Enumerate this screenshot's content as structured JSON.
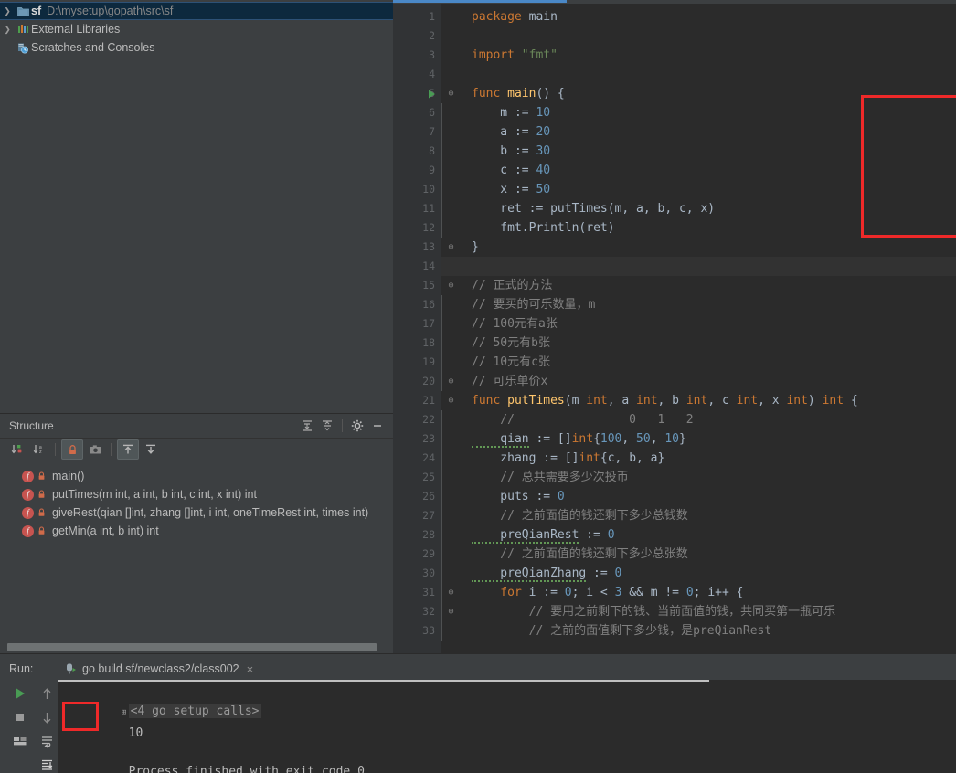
{
  "project_tree": {
    "items": [
      {
        "name": "sf",
        "path": "D:\\mysetup\\gopath\\src\\sf",
        "icon": "folder-module-icon",
        "arrow": "›",
        "selected": true,
        "indent": 0
      },
      {
        "name": "External Libraries",
        "path": "",
        "icon": "libraries-icon",
        "arrow": "›",
        "selected": false,
        "indent": 0
      },
      {
        "name": "Scratches and Consoles",
        "path": "",
        "icon": "scratches-icon",
        "arrow": "",
        "selected": false,
        "indent": 0
      }
    ]
  },
  "structure": {
    "title": "Structure",
    "header_icons": [
      {
        "name": "expand-all-icon"
      },
      {
        "name": "collapse-all-icon"
      },
      {
        "name": "gear-icon"
      },
      {
        "name": "hide-icon"
      }
    ],
    "toolbar_buttons": [
      {
        "name": "sort-by-visibility-icon",
        "active": false
      },
      {
        "name": "sort-alphabetically-icon",
        "active": false
      },
      {
        "name": "show-non-public-icon",
        "active": true
      },
      {
        "name": "show-fields-icon",
        "active": false
      },
      {
        "name": "show-inherited-icon",
        "active": true
      },
      {
        "name": "show-anonymous-icon",
        "active": false
      }
    ],
    "items": [
      {
        "label": "main()"
      },
      {
        "label": "putTimes(m int, a int, b int, c int, x int) int"
      },
      {
        "label": "giveRest(qian []int, zhang []int, i int, oneTimeRest int, times int)"
      },
      {
        "label": "getMin(a int, b int) int"
      }
    ]
  },
  "editor": {
    "lines": [
      {
        "n": 1,
        "fold": "",
        "indent": false,
        "caret": false,
        "tokens": [
          {
            "t": "package ",
            "c": "kw"
          },
          {
            "t": "main",
            "c": "id"
          }
        ]
      },
      {
        "n": 2,
        "fold": "",
        "indent": false,
        "caret": false,
        "tokens": []
      },
      {
        "n": 3,
        "fold": "",
        "indent": false,
        "caret": false,
        "tokens": [
          {
            "t": "import ",
            "c": "kw"
          },
          {
            "t": "\"fmt\"",
            "c": "str"
          }
        ]
      },
      {
        "n": 4,
        "fold": "",
        "indent": false,
        "caret": false,
        "tokens": []
      },
      {
        "n": 5,
        "fold": "⊖",
        "indent": false,
        "caret": false,
        "runmark": true,
        "tokens": [
          {
            "t": "func ",
            "c": "kw"
          },
          {
            "t": "main",
            "c": "fn"
          },
          {
            "t": "() {",
            "c": "id"
          }
        ]
      },
      {
        "n": 6,
        "fold": "",
        "indent": true,
        "caret": false,
        "tokens": [
          {
            "t": "    m := ",
            "c": "id"
          },
          {
            "t": "10",
            "c": "num"
          }
        ]
      },
      {
        "n": 7,
        "fold": "",
        "indent": true,
        "caret": false,
        "tokens": [
          {
            "t": "    a := ",
            "c": "id"
          },
          {
            "t": "20",
            "c": "num"
          }
        ]
      },
      {
        "n": 8,
        "fold": "",
        "indent": true,
        "caret": false,
        "tokens": [
          {
            "t": "    b := ",
            "c": "id"
          },
          {
            "t": "30",
            "c": "num"
          }
        ]
      },
      {
        "n": 9,
        "fold": "",
        "indent": true,
        "caret": false,
        "tokens": [
          {
            "t": "    c := ",
            "c": "id"
          },
          {
            "t": "40",
            "c": "num"
          }
        ]
      },
      {
        "n": 10,
        "fold": "",
        "indent": true,
        "caret": false,
        "tokens": [
          {
            "t": "    x := ",
            "c": "id"
          },
          {
            "t": "50",
            "c": "num"
          }
        ]
      },
      {
        "n": 11,
        "fold": "",
        "indent": true,
        "caret": false,
        "tokens": [
          {
            "t": "    ret := ",
            "c": "id"
          },
          {
            "t": "putTimes",
            "c": "id"
          },
          {
            "t": "(m, a, b, c, x)",
            "c": "id"
          }
        ]
      },
      {
        "n": 12,
        "fold": "",
        "indent": true,
        "caret": false,
        "tokens": [
          {
            "t": "    fmt.",
            "c": "id"
          },
          {
            "t": "Println",
            "c": "id"
          },
          {
            "t": "(ret)",
            "c": "id"
          }
        ]
      },
      {
        "n": 13,
        "fold": "⊖",
        "indent": false,
        "caret": false,
        "tokens": [
          {
            "t": "}",
            "c": "id"
          }
        ]
      },
      {
        "n": 14,
        "fold": "",
        "indent": false,
        "caret": true,
        "tokens": []
      },
      {
        "n": 15,
        "fold": "⊖",
        "indent": false,
        "caret": false,
        "tokens": [
          {
            "t": "// 正式的方法",
            "c": "cmt"
          }
        ]
      },
      {
        "n": 16,
        "fold": "",
        "indent": true,
        "caret": false,
        "tokens": [
          {
            "t": "// 要买的可乐数量，m",
            "c": "cmt"
          }
        ]
      },
      {
        "n": 17,
        "fold": "",
        "indent": true,
        "caret": false,
        "tokens": [
          {
            "t": "// 100元有a张",
            "c": "cmt"
          }
        ]
      },
      {
        "n": 18,
        "fold": "",
        "indent": true,
        "caret": false,
        "tokens": [
          {
            "t": "// 50元有b张",
            "c": "cmt"
          }
        ]
      },
      {
        "n": 19,
        "fold": "",
        "indent": true,
        "caret": false,
        "tokens": [
          {
            "t": "// 10元有c张",
            "c": "cmt"
          }
        ]
      },
      {
        "n": 20,
        "fold": "⊖",
        "indent": true,
        "caret": false,
        "tokens": [
          {
            "t": "// 可乐单价x",
            "c": "cmt"
          }
        ]
      },
      {
        "n": 21,
        "fold": "⊖",
        "indent": false,
        "caret": false,
        "tokens": [
          {
            "t": "func ",
            "c": "kw"
          },
          {
            "t": "putTimes",
            "c": "fn"
          },
          {
            "t": "(m ",
            "c": "id"
          },
          {
            "t": "int",
            "c": "typ"
          },
          {
            "t": ", a ",
            "c": "id"
          },
          {
            "t": "int",
            "c": "typ"
          },
          {
            "t": ", b ",
            "c": "id"
          },
          {
            "t": "int",
            "c": "typ"
          },
          {
            "t": ", c ",
            "c": "id"
          },
          {
            "t": "int",
            "c": "typ"
          },
          {
            "t": ", x ",
            "c": "id"
          },
          {
            "t": "int",
            "c": "typ"
          },
          {
            "t": ") ",
            "c": "id"
          },
          {
            "t": "int",
            "c": "typ"
          },
          {
            "t": " {",
            "c": "id"
          }
        ]
      },
      {
        "n": 22,
        "fold": "",
        "indent": true,
        "caret": false,
        "tokens": [
          {
            "t": "    //                0   1   2",
            "c": "cmt"
          }
        ]
      },
      {
        "n": 23,
        "fold": "",
        "indent": true,
        "caret": false,
        "tokens": [
          {
            "t": "    qian",
            "c": "id",
            "wavy": true
          },
          {
            "t": " := []",
            "c": "id"
          },
          {
            "t": "int",
            "c": "typ"
          },
          {
            "t": "{",
            "c": "id"
          },
          {
            "t": "100",
            "c": "num"
          },
          {
            "t": ", ",
            "c": "id"
          },
          {
            "t": "50",
            "c": "num"
          },
          {
            "t": ", ",
            "c": "id"
          },
          {
            "t": "10",
            "c": "num"
          },
          {
            "t": "}",
            "c": "id"
          }
        ]
      },
      {
        "n": 24,
        "fold": "",
        "indent": true,
        "caret": false,
        "tokens": [
          {
            "t": "    zhang := []",
            "c": "id"
          },
          {
            "t": "int",
            "c": "typ"
          },
          {
            "t": "{c, b, a}",
            "c": "id"
          }
        ]
      },
      {
        "n": 25,
        "fold": "",
        "indent": true,
        "caret": false,
        "tokens": [
          {
            "t": "    // 总共需要多少次投币",
            "c": "cmt"
          }
        ]
      },
      {
        "n": 26,
        "fold": "",
        "indent": true,
        "caret": false,
        "tokens": [
          {
            "t": "    puts := ",
            "c": "id"
          },
          {
            "t": "0",
            "c": "num"
          }
        ]
      },
      {
        "n": 27,
        "fold": "",
        "indent": true,
        "caret": false,
        "tokens": [
          {
            "t": "    // 之前面值的钱还剩下多少总钱数",
            "c": "cmt"
          }
        ]
      },
      {
        "n": 28,
        "fold": "",
        "indent": true,
        "caret": false,
        "tokens": [
          {
            "t": "    preQianRest",
            "c": "id",
            "wavy": true
          },
          {
            "t": " := ",
            "c": "id"
          },
          {
            "t": "0",
            "c": "num"
          }
        ]
      },
      {
        "n": 29,
        "fold": "",
        "indent": true,
        "caret": false,
        "tokens": [
          {
            "t": "    // 之前面值的钱还剩下多少总张数",
            "c": "cmt"
          }
        ]
      },
      {
        "n": 30,
        "fold": "",
        "indent": true,
        "caret": false,
        "tokens": [
          {
            "t": "    preQianZhang",
            "c": "id",
            "wavy": true
          },
          {
            "t": " := ",
            "c": "id"
          },
          {
            "t": "0",
            "c": "num"
          }
        ]
      },
      {
        "n": 31,
        "fold": "⊖",
        "indent": true,
        "caret": false,
        "tokens": [
          {
            "t": "    for ",
            "c": "kw"
          },
          {
            "t": "i := ",
            "c": "id"
          },
          {
            "t": "0",
            "c": "num"
          },
          {
            "t": "; i < ",
            "c": "id"
          },
          {
            "t": "3",
            "c": "num"
          },
          {
            "t": " && m != ",
            "c": "id"
          },
          {
            "t": "0",
            "c": "num"
          },
          {
            "t": "; i++ {",
            "c": "id"
          }
        ]
      },
      {
        "n": 32,
        "fold": "⊖",
        "indent": true,
        "caret": false,
        "tokens": [
          {
            "t": "        // 要用之前剩下的钱、当前面值的钱，共同买第一瓶可乐",
            "c": "cmt"
          }
        ]
      },
      {
        "n": 33,
        "fold": "",
        "indent": true,
        "caret": false,
        "tokens": [
          {
            "t": "        // 之前的面值剩下多少钱，是preQianRest",
            "c": "cmt"
          }
        ]
      }
    ],
    "highlight_box": {
      "color": "#ef2929"
    }
  },
  "run_panel": {
    "label": "Run:",
    "tab_title": "go build sf/newclass2/class002",
    "tab_close": "×",
    "console": {
      "setup_line": "<4 go setup calls>",
      "output": "10",
      "finished": "Process finished with exit code 0"
    },
    "toolbar_left": [
      {
        "name": "run-icon"
      },
      {
        "name": "stop-icon"
      },
      {
        "name": "layout-icon"
      }
    ],
    "toolbar_right": [
      {
        "name": "arrow-up-icon"
      },
      {
        "name": "arrow-down-icon"
      },
      {
        "name": "soft-wrap-icon"
      },
      {
        "name": "scroll-to-end-icon"
      }
    ],
    "highlight_box": {
      "color": "#ef2929"
    }
  },
  "colors": {
    "editor_bg": "#2b2b2b",
    "panel_bg": "#3c3f41",
    "gutter_bg": "#313335",
    "selection_bg": "#0d293e",
    "accent_red": "#ef2929",
    "keyword": "#cc7832",
    "number": "#6897bb",
    "string": "#6a8759",
    "function": "#ffc66d",
    "comment": "#808080",
    "identifier": "#a9b7c6"
  }
}
